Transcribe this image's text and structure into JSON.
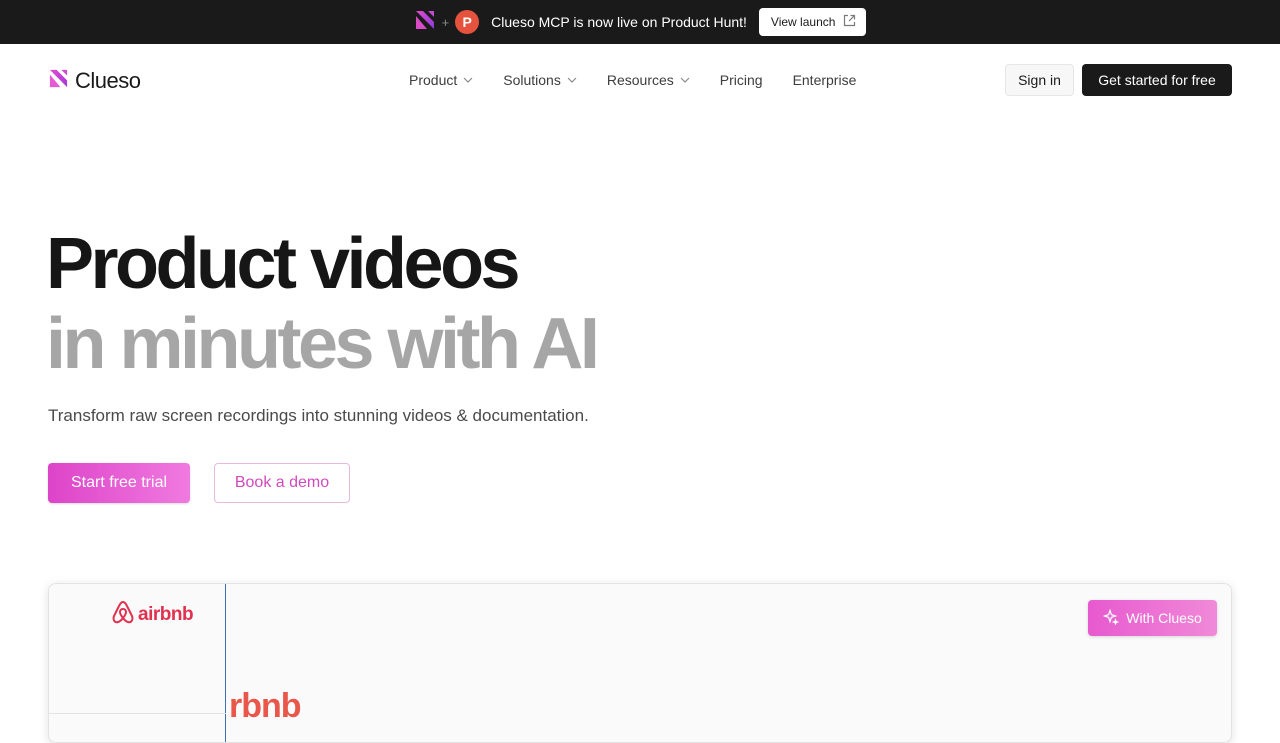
{
  "announcement": {
    "text": "Clueso MCP is now live on Product Hunt!",
    "plus": "+",
    "ph_letter": "P",
    "button_label": "View launch"
  },
  "nav": {
    "brand": "Clueso",
    "menu": [
      {
        "label": "Product",
        "has_dropdown": true
      },
      {
        "label": "Solutions",
        "has_dropdown": true
      },
      {
        "label": "Resources",
        "has_dropdown": true
      },
      {
        "label": "Pricing",
        "has_dropdown": false
      },
      {
        "label": "Enterprise",
        "has_dropdown": false
      }
    ],
    "signin": "Sign in",
    "get_started": "Get started for free"
  },
  "hero": {
    "title_line1": "Product videos",
    "title_line2": "in minutes with AI",
    "subtitle": "Transform raw screen recordings into stunning videos & documentation.",
    "primary_cta": "Start free trial",
    "secondary_cta": "Book a demo"
  },
  "demo": {
    "logo_text": "airbnb",
    "canvas_text": "rbnb",
    "badge": "With Clueso"
  },
  "colors": {
    "accent_start": "#dd44c8",
    "accent_end": "#f07ae0",
    "airbnb": "#e0314f",
    "dark": "#1a1a1a"
  }
}
